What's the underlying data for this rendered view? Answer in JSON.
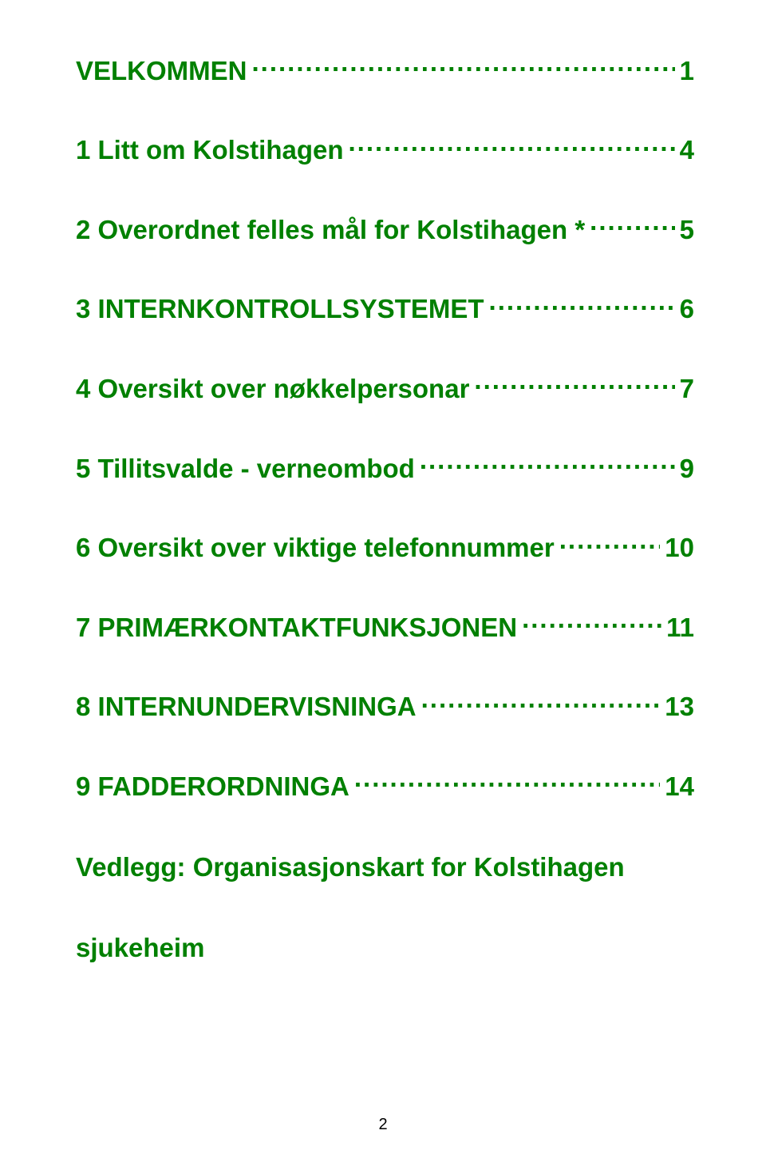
{
  "toc": [
    {
      "label": "VELKOMMEN",
      "page": "1"
    },
    {
      "label": "1 Litt om Kolstihagen",
      "page": "4"
    },
    {
      "label": "2 Overordnet felles mål for Kolstihagen *",
      "page": "5"
    },
    {
      "label": "3 INTERNKONTROLLSYSTEMET",
      "page": "6"
    },
    {
      "label": "4 Oversikt over nøkkelpersonar",
      "page": "7"
    },
    {
      "label": "5 Tillitsvalde - verneombod",
      "page": "9"
    },
    {
      "label": "6 Oversikt over viktige telefonnummer",
      "page": "10"
    },
    {
      "label": "7 PRIMÆRKONTAKTFUNKSJONEN",
      "page": "11"
    },
    {
      "label": "8 INTERNUNDERVISNINGA",
      "page": "13"
    },
    {
      "label": "9 FADDERORDNINGA",
      "page": "14"
    }
  ],
  "appendix": {
    "line1": "Vedlegg: Organisasjonskart for Kolstihagen",
    "line2": "sjukeheim"
  },
  "page_number": "2"
}
